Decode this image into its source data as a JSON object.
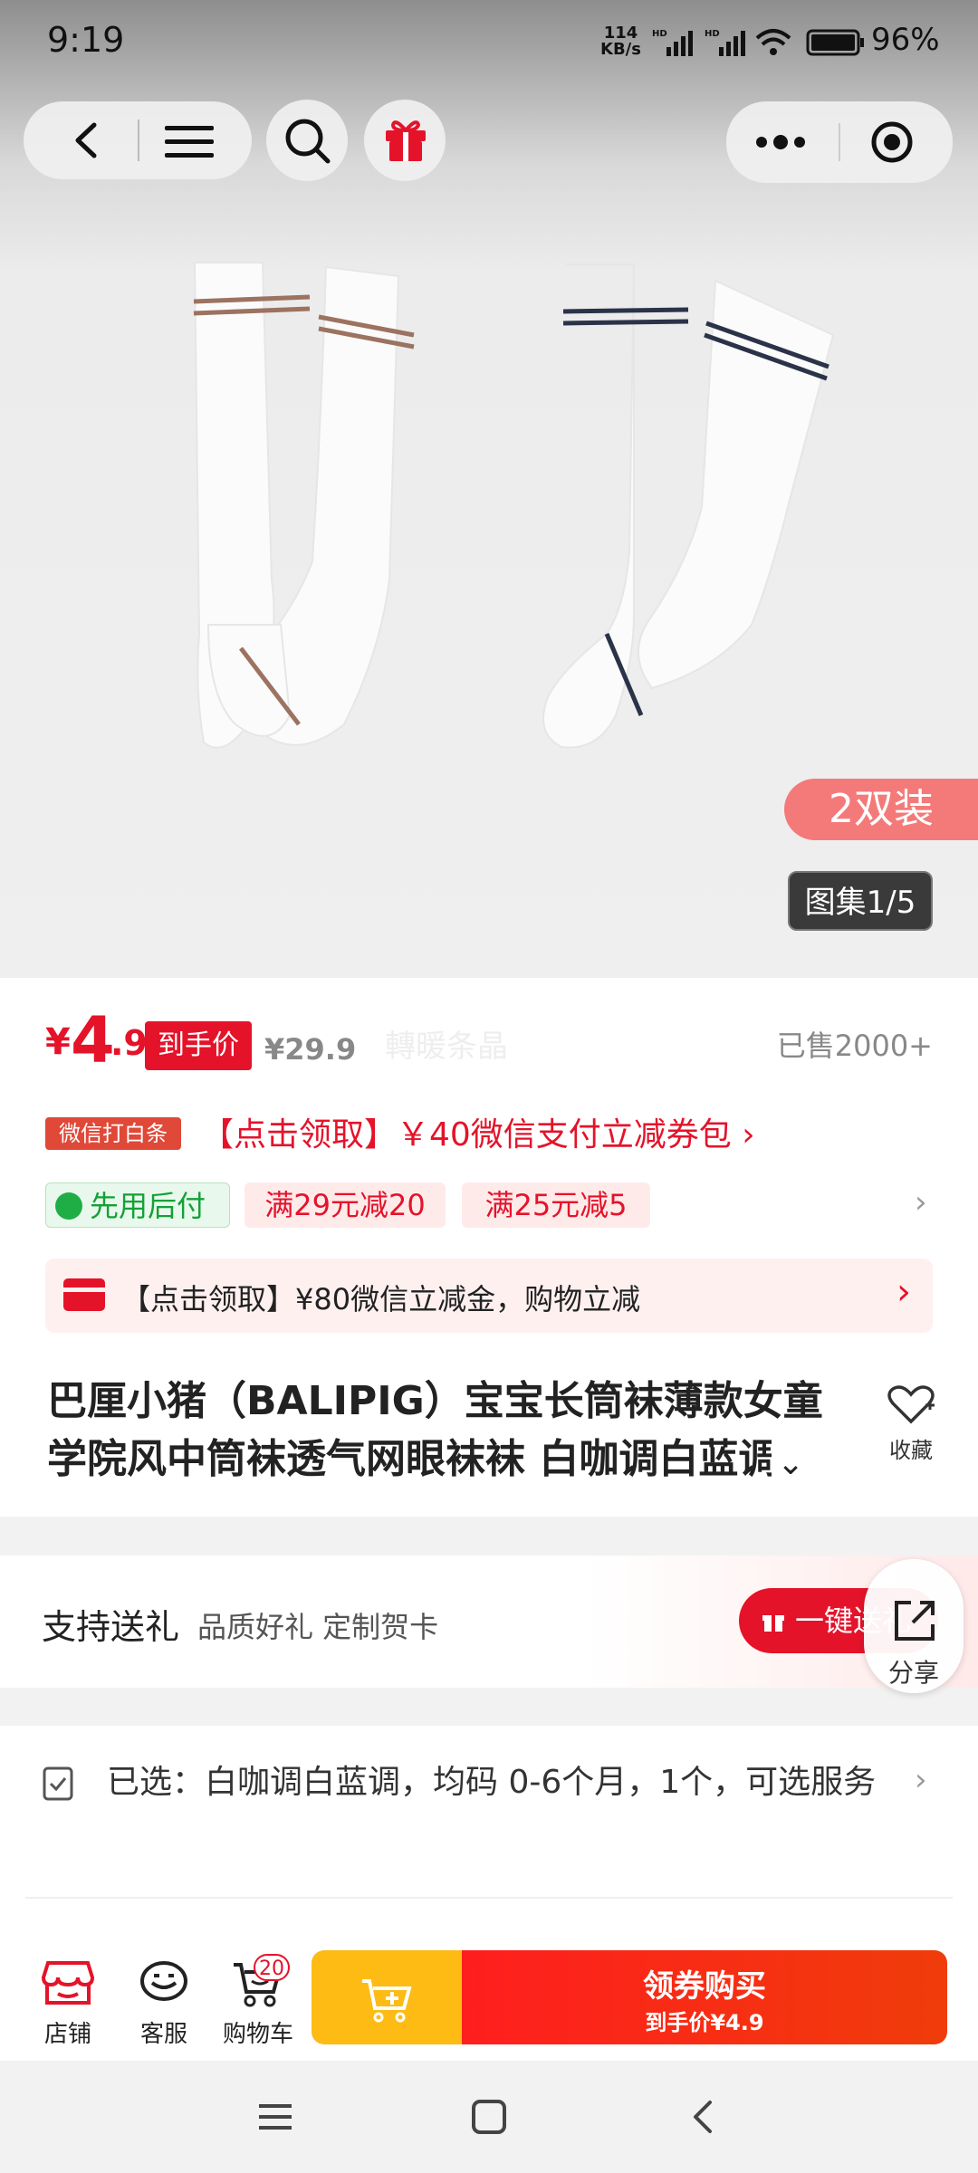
{
  "status_bar": {
    "time": "9:19",
    "speed_value": "114",
    "speed_unit": "KB/s",
    "battery": "96%"
  },
  "hero": {
    "badge_pack": "2双装",
    "gallery_index": "图集1/5"
  },
  "price": {
    "currency": "¥",
    "integer": "4",
    "decimal": ".9",
    "tag": "到手价",
    "original": "¥29.9",
    "watermark": "轉暖条晶",
    "sold": "已售2000+"
  },
  "promos": {
    "wechat_tag": "微信打白条",
    "wechat_coupon": "【点击领取】￥40微信支付立减券包 ›",
    "pay_later": "先用后付",
    "coupons": [
      "满29元减20",
      "满25元减5"
    ],
    "banner_text": "【点击领取】¥80微信立减金，购物立减"
  },
  "product": {
    "title_line1": "巴厘小猪（BALIPIG）宝宝长筒袜薄款女童",
    "title_line2": "学院风中筒袜透气网眼袜袜 白咖调白蓝调",
    "favorite_label": "收藏"
  },
  "gift": {
    "title": "支持送礼",
    "subtitle": "品质好礼 定制贺卡",
    "button": "一键送礼",
    "share_label": "分享"
  },
  "selection": {
    "text": "已选：白咖调白蓝调，均码 0-6个月，1个，可选服务"
  },
  "bottom_bar": {
    "store_label": "店铺",
    "service_label": "客服",
    "cart_label": "购物车",
    "cart_count": "20",
    "buy_label": "领券购买",
    "buy_sub": "到手价¥4.9"
  },
  "colors": {
    "accent": "#e4132a",
    "add_cart": "#fdbb14",
    "pay_later_green": "#14a136"
  }
}
